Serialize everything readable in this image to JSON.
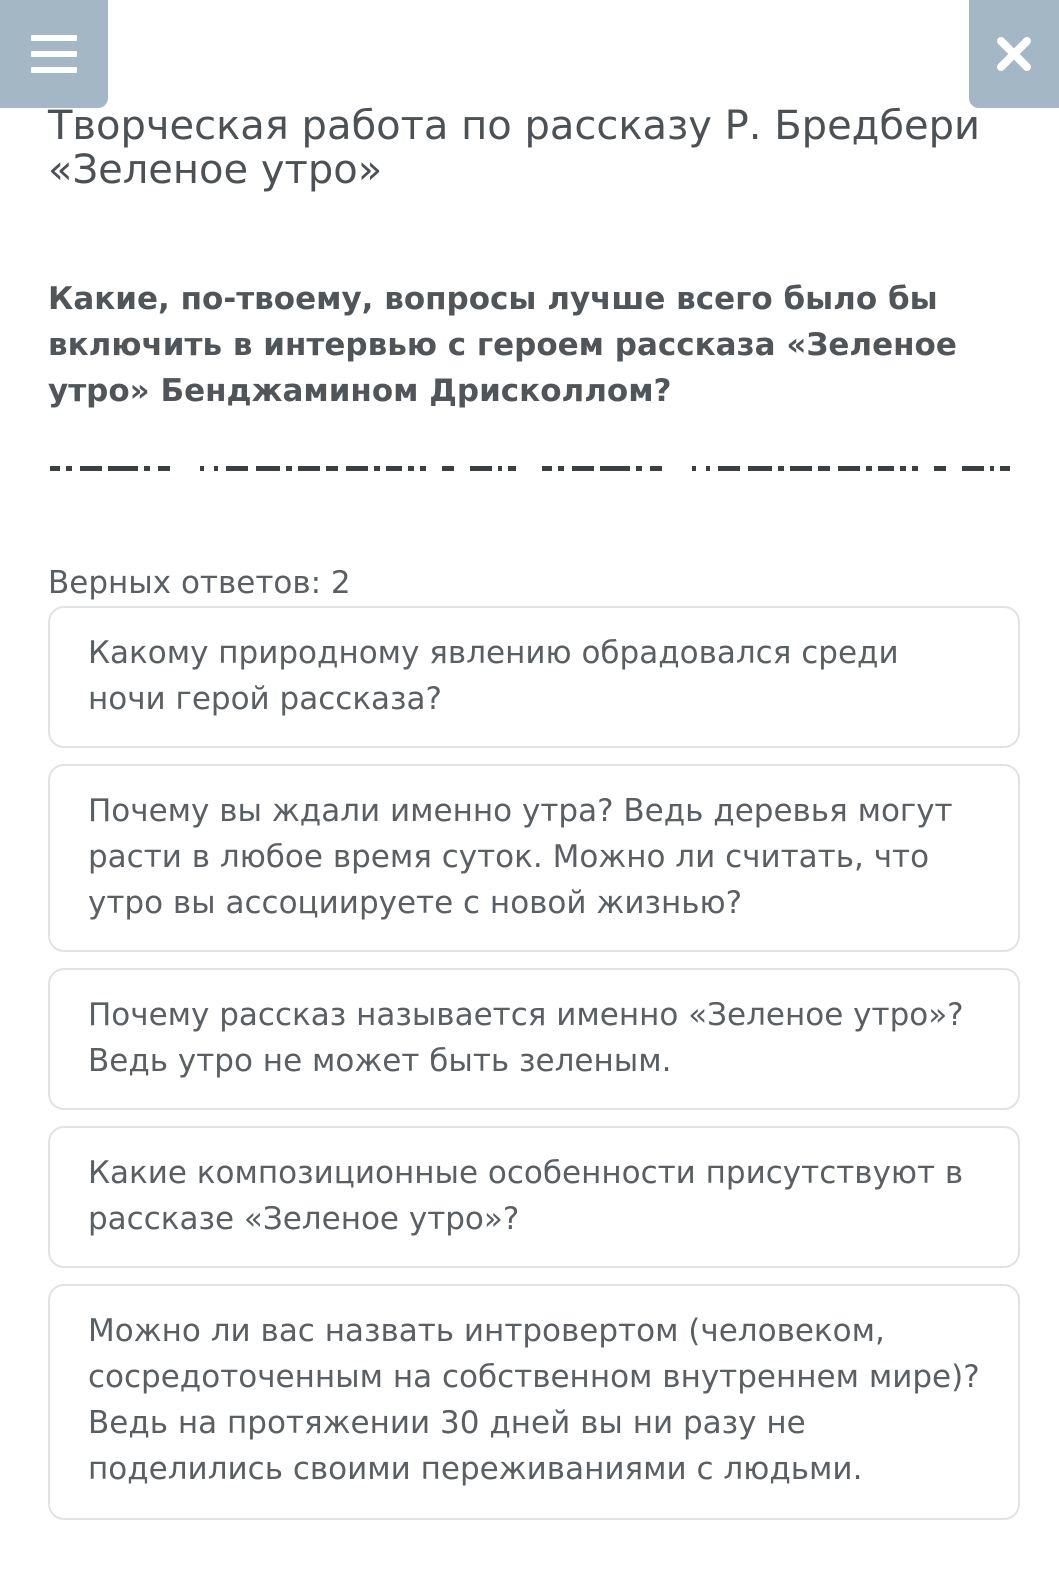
{
  "header": {
    "menu_icon": "hamburger-menu-icon",
    "close_icon": "close-x-icon",
    "button_color": "#a3b8c4"
  },
  "title": "Творческая работа по рассказу Р. Бредбери «Зеленое утро»",
  "question": "Какие, по-твоему, вопросы лучше всего было бы включить в интервью с героем рассказа «Зеленое утро» Бенджамином Дрисколлом?",
  "answers_label": "Верных ответов: 2",
  "answers": [
    "Какому природному явлению обрадовался среди ночи герой рассказа?",
    "Почему вы ждали именно утра? Ведь деревья могут расти в любое время суток. Можно ли считать, что утро вы ассоциируете с новой жизнью?",
    "Почему рассказ называется именно «Зеленое утро»? Ведь утро не может быть зеленым.",
    "Какие композиционные особенности присутствуют в рассказе «Зеленое утро»?",
    "Можно ли вас назвать интровертом (человеком, сосредоточенным на собственном внутреннем мире)? Ведь на протяжении 30 дней вы ни разу не поделились своими переживаниями с людьми."
  ]
}
